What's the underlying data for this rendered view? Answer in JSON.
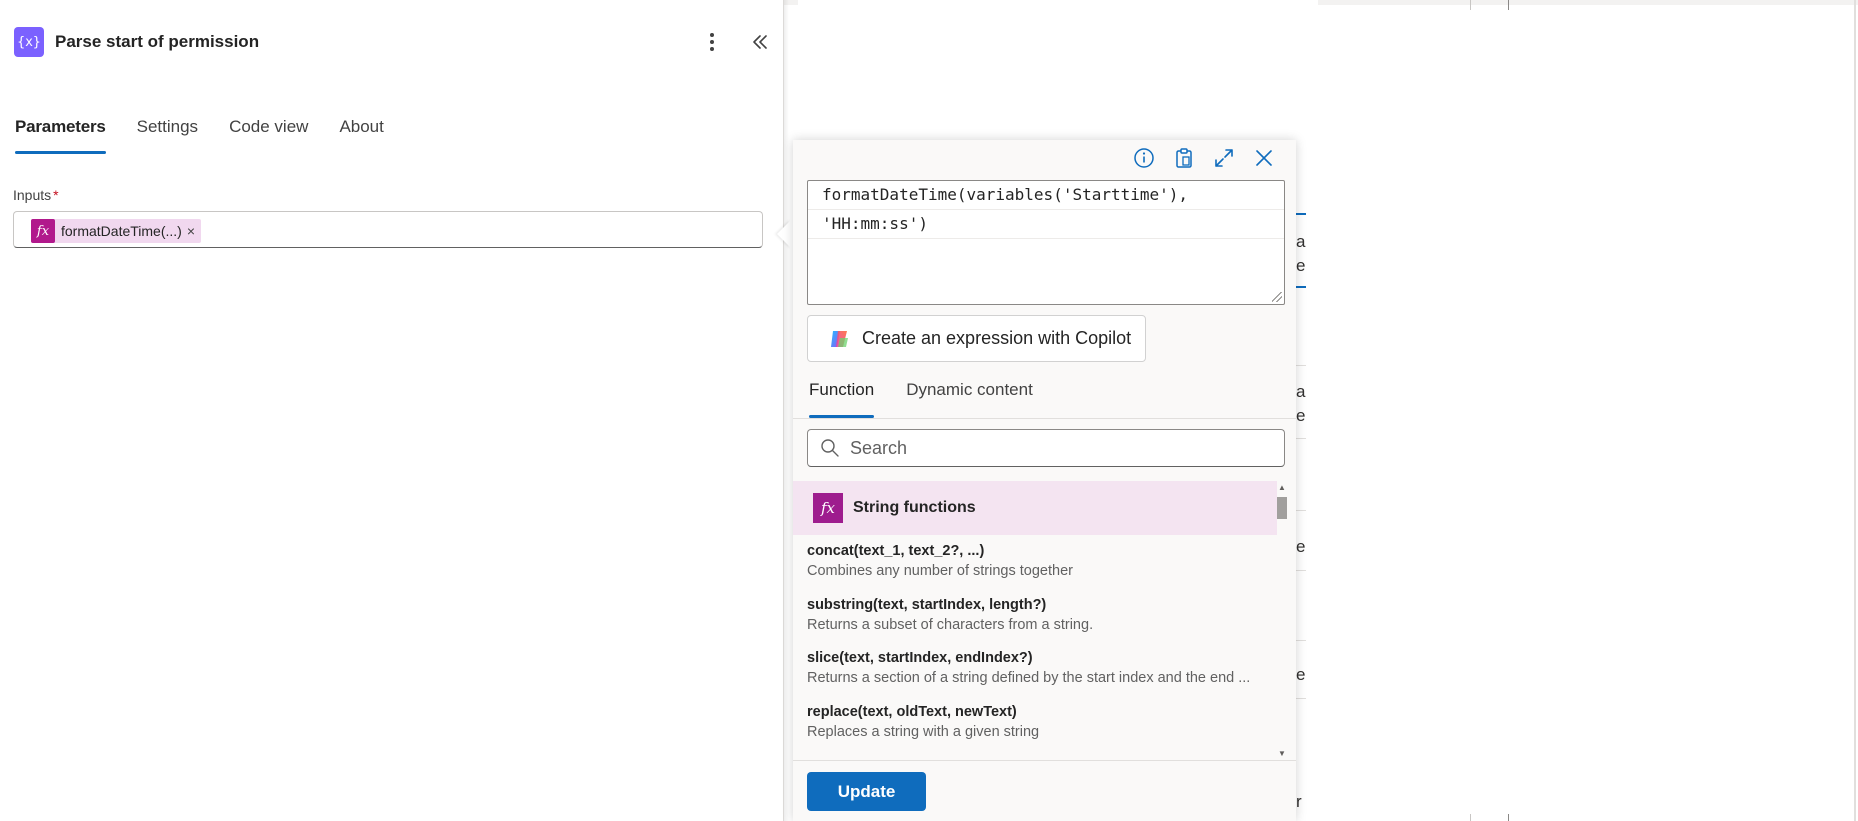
{
  "panel": {
    "title": "Parse start of permission",
    "action_icon": "variable-braces-icon",
    "action_icon_glyph": "{x}",
    "tabs": [
      "Parameters",
      "Settings",
      "Code view",
      "About"
    ],
    "active_tab": "Parameters"
  },
  "inputs": {
    "label": "Inputs",
    "required_marker": "*",
    "token_label": "formatDateTime(...)",
    "token_remove": "×",
    "token_glyph": "fx"
  },
  "expression_editor": {
    "line1": "formatDateTime(variables('Starttime'),",
    "line2": "'HH:mm:ss')",
    "copilot_label": "Create an expression with Copilot",
    "tabs": [
      "Function",
      "Dynamic content"
    ],
    "active_tab": "Function",
    "search_placeholder": "Search",
    "group": {
      "glyph": "fx",
      "title": "String functions"
    },
    "functions": [
      {
        "signature": "concat(text_1, text_2?, ...)",
        "description": "Combines any number of strings together"
      },
      {
        "signature": "substring(text, startIndex, length?)",
        "description": "Returns a subset of characters from a string."
      },
      {
        "signature": "slice(text, startIndex, endIndex?)",
        "description": "Returns a section of a string defined by the start index and the end ..."
      },
      {
        "signature": "replace(text, oldText, newText)",
        "description": "Replaces a string with a given string"
      }
    ],
    "update_label": "Update"
  },
  "behind_fragments": [
    "a",
    "e",
    "a",
    "e",
    "e",
    "e",
    "r"
  ],
  "colors": {
    "accent": "#0f6cbd",
    "action_icon": "#7b61ff",
    "expression_token": "#b1198c",
    "group_header_bg": "#f4e4f1"
  }
}
